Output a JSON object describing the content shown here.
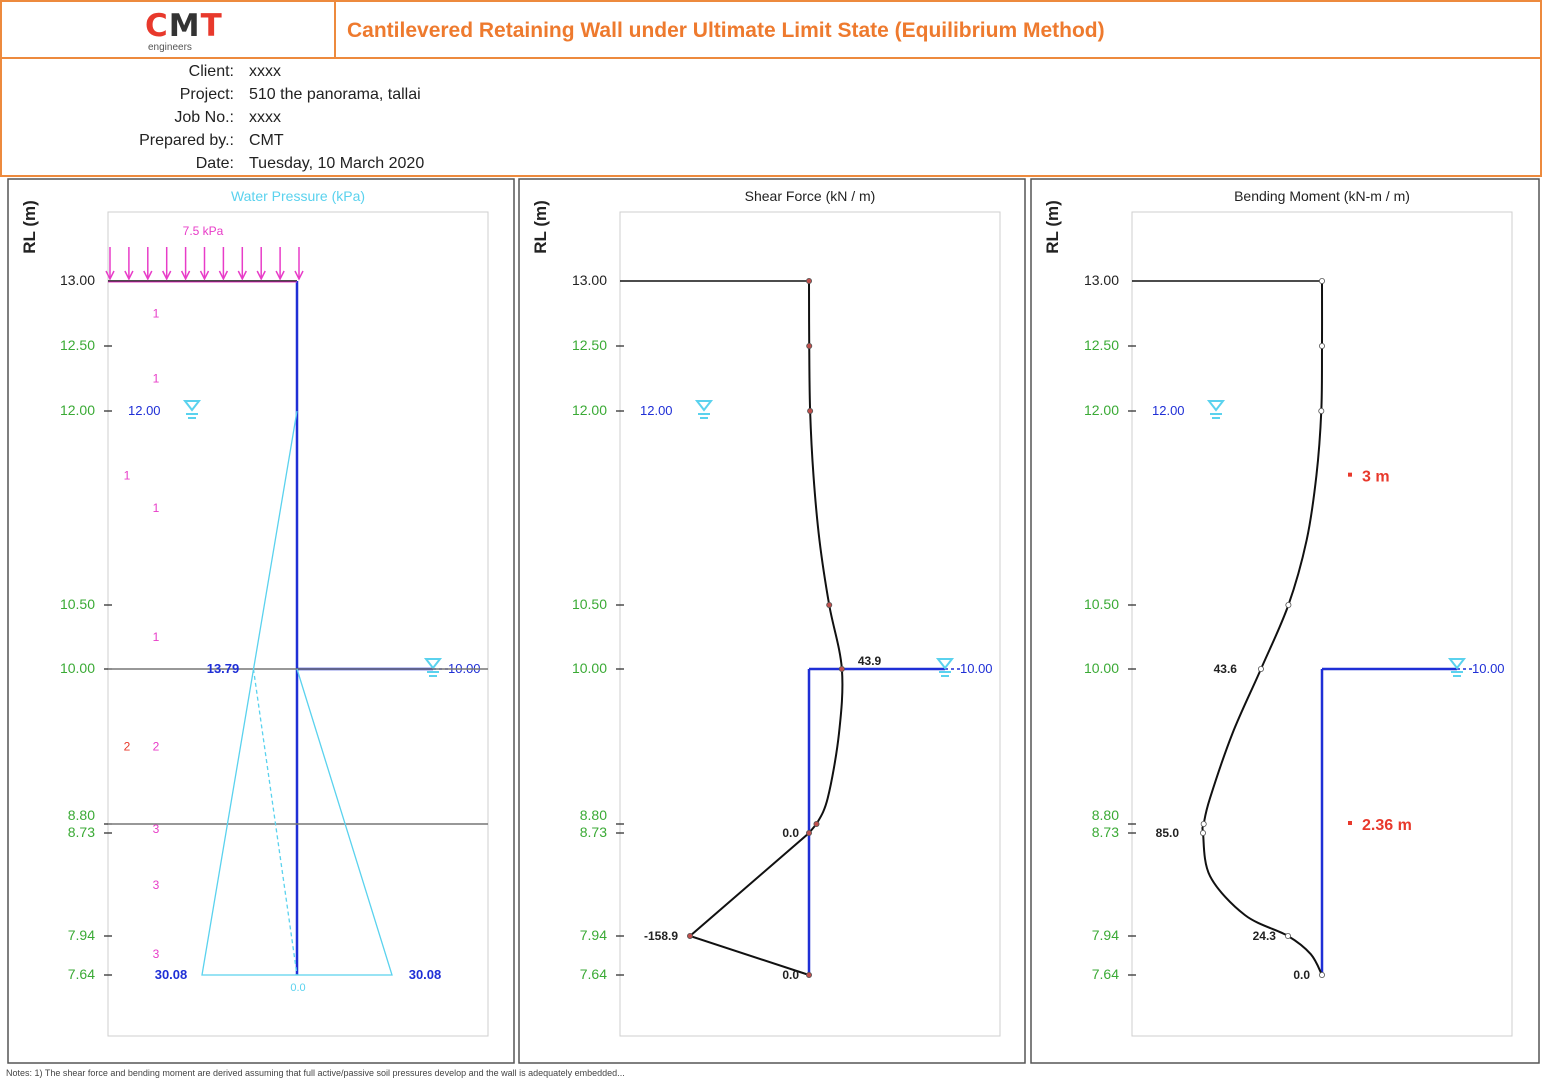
{
  "logo": {
    "mark_left": "C",
    "mark_mid": "M",
    "mark_right": "T",
    "subtitle": "engineers"
  },
  "report_title": "Cantilevered Retaining Wall under Ultimate Limit State (Equilibrium Method)",
  "project_info": [
    {
      "label": "Client:",
      "value": "xxxx"
    },
    {
      "label": "Project:",
      "value": "510 the panorama, tallai"
    },
    {
      "label": "Job No.:",
      "value": "xxxx"
    },
    {
      "label": "Prepared by.:",
      "value": "CMT"
    },
    {
      "label": "Date:",
      "value": "Tuesday, 10 March 2020"
    }
  ],
  "colors": {
    "orange": "#ed8a3d",
    "wall_blue": "#1f2fd6",
    "water_cyan": "#5ad2ee",
    "tick_green": "#3aaa35",
    "pink": "#e83cc8",
    "red": "#e8392c",
    "curve": "#111111"
  },
  "chart_data": [
    {
      "type": "line",
      "title": "Water Pressure (kPa)",
      "ylabel": "RL (m)",
      "yticks": [
        "13.00",
        "12.50",
        "12.00",
        "10.50",
        "10.00",
        "8.80",
        "8.73",
        "7.94",
        "7.64"
      ],
      "ylim": [
        7.0,
        13.5
      ],
      "surcharge_label": "7.5 kPa",
      "water_tables": [
        {
          "rl": 12.0,
          "label": "12.00",
          "side": "left"
        },
        {
          "rl": 10.0,
          "label": "10.00",
          "side": "right"
        }
      ],
      "layer_lines": [
        10.0,
        8.8
      ],
      "layer_numbers": [
        {
          "rl": 12.75,
          "label": "1",
          "col": "b"
        },
        {
          "rl": 12.25,
          "label": "1",
          "col": "b"
        },
        {
          "rl": 11.5,
          "label": "1",
          "col": "a"
        },
        {
          "rl": 11.25,
          "label": "1",
          "col": "b"
        },
        {
          "rl": 10.25,
          "label": "1",
          "col": "b"
        },
        {
          "rl": 9.4,
          "label": "2",
          "col": "a"
        },
        {
          "rl": 9.4,
          "label": "2",
          "col": "b"
        },
        {
          "rl": 8.76,
          "label": "3",
          "col": "b"
        },
        {
          "rl": 8.33,
          "label": "3",
          "col": "b"
        },
        {
          "rl": 7.8,
          "label": "3",
          "col": "b"
        }
      ],
      "value_labels": [
        {
          "rl": 10.0,
          "label": "13.79",
          "side": "left"
        },
        {
          "rl": 7.64,
          "label": "30.08",
          "side": "left"
        },
        {
          "rl": 7.64,
          "label": "30.08",
          "side": "right"
        },
        {
          "rl": 7.64,
          "label": "0.0",
          "side": "wall"
        }
      ],
      "series": [
        {
          "name": "",
          "values": [
            {
              "rl": 12.0,
              "p": 0
            },
            {
              "rl": 7.64,
              "p": 30.08
            }
          ]
        },
        {
          "name": "",
          "values": [
            {
              "rl": 12.0,
              "p": 0
            },
            {
              "rl": 10.0,
              "p": 13.79
            },
            {
              "rl": 7.64,
              "p": 0.0
            }
          ]
        },
        {
          "name": "",
          "values": [
            {
              "rl": 10.0,
              "p": 0
            },
            {
              "rl": 7.64,
              "p": 30.08
            }
          ]
        }
      ]
    },
    {
      "type": "line",
      "title": "Shear Force  (kN / m)",
      "ylabel": "RL (m)",
      "yticks": [
        "13.00",
        "12.50",
        "12.00",
        "10.50",
        "10.00",
        "8.80",
        "8.73",
        "7.94",
        "7.64"
      ],
      "ylim": [
        7.0,
        13.5
      ],
      "water_tables": [
        {
          "rl": 12.0,
          "label": "12.00",
          "side": "left"
        },
        {
          "rl": 10.0,
          "label": "10.00",
          "side": "right"
        }
      ],
      "series": [
        {
          "name": "",
          "values": [
            {
              "rl": 13.0,
              "v": 0
            },
            {
              "rl": 12.5,
              "v": 0.3
            },
            {
              "rl": 12.0,
              "v": 1.5
            },
            {
              "rl": 11.5,
              "v": 6.0
            },
            {
              "rl": 11.0,
              "v": 14.0
            },
            {
              "rl": 10.5,
              "v": 27.0
            },
            {
              "rl": 10.0,
              "v": 43.9
            },
            {
              "rl": 9.5,
              "v": 40.0
            },
            {
              "rl": 9.0,
              "v": 25.0
            },
            {
              "rl": 8.8,
              "v": 10.0
            },
            {
              "rl": 8.73,
              "v": 0.0
            },
            {
              "rl": 7.94,
              "v": -158.9
            },
            {
              "rl": 7.64,
              "v": 0.0
            }
          ]
        }
      ],
      "data_labels": [
        {
          "rl": 10.0,
          "v": 43.9,
          "label": "43.9"
        },
        {
          "rl": 8.73,
          "v": 0.0,
          "label": "0.0"
        },
        {
          "rl": 7.94,
          "v": -158.9,
          "label": "-158.9"
        },
        {
          "rl": 7.64,
          "v": 0.0,
          "label": "0.0"
        }
      ]
    },
    {
      "type": "line",
      "title": "Bending Moment  (kN-m / m)",
      "ylabel": "RL (m)",
      "yticks": [
        "13.00",
        "12.50",
        "12.00",
        "10.50",
        "10.00",
        "8.80",
        "8.73",
        "7.94",
        "7.64"
      ],
      "ylim": [
        7.0,
        13.5
      ],
      "water_tables": [
        {
          "rl": 12.0,
          "label": "12.00",
          "side": "left"
        },
        {
          "rl": 10.0,
          "label": "10.00",
          "side": "right"
        }
      ],
      "annotations": [
        {
          "rl": 11.5,
          "label": "3 m"
        },
        {
          "rl": 8.8,
          "label": "2.36 m"
        }
      ],
      "series": [
        {
          "name": "",
          "values": [
            {
              "rl": 13.0,
              "m": 0
            },
            {
              "rl": 12.5,
              "m": 0
            },
            {
              "rl": 12.0,
              "m": 0.5
            },
            {
              "rl": 11.5,
              "m": 4.0
            },
            {
              "rl": 11.0,
              "m": 11.0
            },
            {
              "rl": 10.5,
              "m": 24.0
            },
            {
              "rl": 10.0,
              "m": 43.6
            },
            {
              "rl": 9.5,
              "m": 64.0
            },
            {
              "rl": 9.0,
              "m": 80.0
            },
            {
              "rl": 8.8,
              "m": 84.5
            },
            {
              "rl": 8.73,
              "m": 85.0
            },
            {
              "rl": 8.4,
              "m": 80.0
            },
            {
              "rl": 8.1,
              "m": 55.0
            },
            {
              "rl": 7.94,
              "m": 24.3
            },
            {
              "rl": 7.8,
              "m": 8.0
            },
            {
              "rl": 7.64,
              "m": 0.0
            }
          ]
        }
      ],
      "data_labels": [
        {
          "rl": 10.0,
          "m": 43.6,
          "label": "43.6"
        },
        {
          "rl": 8.73,
          "m": 85.0,
          "label": "85.0"
        },
        {
          "rl": 7.94,
          "m": 24.3,
          "label": "24.3"
        },
        {
          "rl": 7.64,
          "m": 0.0,
          "label": "0.0"
        }
      ]
    }
  ],
  "note_text": "Notes: 1) The shear force and bending moment are derived assuming that full active/passive soil pressures develop and the wall is adequately embedded..."
}
